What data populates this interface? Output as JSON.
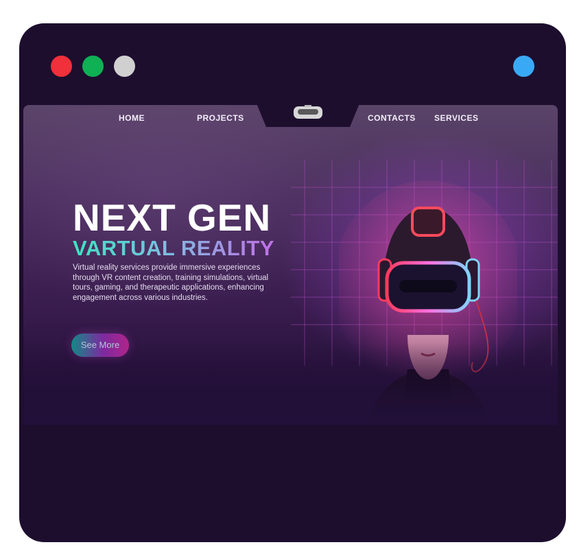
{
  "window": {
    "dot_colors": [
      "#f0303a",
      "#10b055",
      "#d0d0d0"
    ],
    "right_dot_color": "#3aa9f5"
  },
  "nav": {
    "items": [
      {
        "label": "HOME"
      },
      {
        "label": "PROJECTS"
      },
      {
        "label": "CONTACTS"
      },
      {
        "label": "SERVICES"
      }
    ],
    "logo_icon": "vr-headset-icon"
  },
  "hero": {
    "title_line1": "NEXT GEN",
    "title_line2": "VARTUAL REALITY",
    "description": "Virtual reality services provide immersive experiences through VR content creation, training simulations, virtual tours, gaming, and therapeutic applications, enhancing engagement across various industries.",
    "cta_label": "See More",
    "accent_teal": "#3ee3c0",
    "accent_purple": "#c26ee6"
  }
}
